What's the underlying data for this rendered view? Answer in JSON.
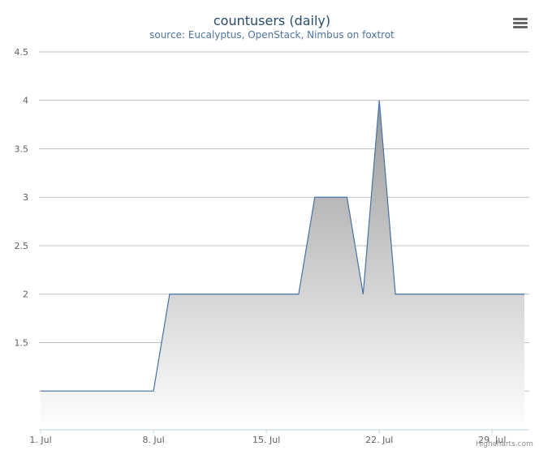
{
  "chart_data": {
    "type": "area",
    "title": "countusers (daily)",
    "subtitle": "source: Eucalyptus, OpenStack, Nimbus on foxtrot",
    "xlabel": "",
    "ylabel": "",
    "x": [
      "2014-07-01",
      "2014-07-02",
      "2014-07-03",
      "2014-07-04",
      "2014-07-05",
      "2014-07-06",
      "2014-07-07",
      "2014-07-08",
      "2014-07-09",
      "2014-07-10",
      "2014-07-11",
      "2014-07-12",
      "2014-07-13",
      "2014-07-14",
      "2014-07-15",
      "2014-07-16",
      "2014-07-17",
      "2014-07-18",
      "2014-07-19",
      "2014-07-20",
      "2014-07-21",
      "2014-07-22",
      "2014-07-23",
      "2014-07-24",
      "2014-07-25",
      "2014-07-26",
      "2014-07-27",
      "2014-07-28",
      "2014-07-29",
      "2014-07-30",
      "2014-07-31"
    ],
    "series": [
      {
        "values": [
          1,
          1,
          1,
          1,
          1,
          1,
          1,
          1,
          2,
          2,
          2,
          2,
          2,
          2,
          2,
          2,
          2,
          3,
          3,
          3,
          2,
          4,
          2,
          2,
          2,
          2,
          2,
          2,
          2,
          2,
          2
        ]
      }
    ],
    "x_ticks": [
      "1. Jul",
      "8. Jul",
      "15. Jul",
      "22. Jul",
      "29. Jul"
    ],
    "y_ticks": [
      "1.5",
      "2",
      "2.5",
      "3",
      "3.5",
      "4",
      "4.5"
    ],
    "ylim": [
      0.6,
      4.5
    ],
    "grid": true,
    "legend": "none",
    "colors": {
      "line": "#4572a7",
      "fill_top": "#999999",
      "fill_bottom": "#ffffff",
      "grid": "#c0c0c0",
      "axis": "#c0d0e0"
    }
  },
  "ui": {
    "credits": "Highcharts.com",
    "menu_icon": "hamburger-menu-icon"
  }
}
